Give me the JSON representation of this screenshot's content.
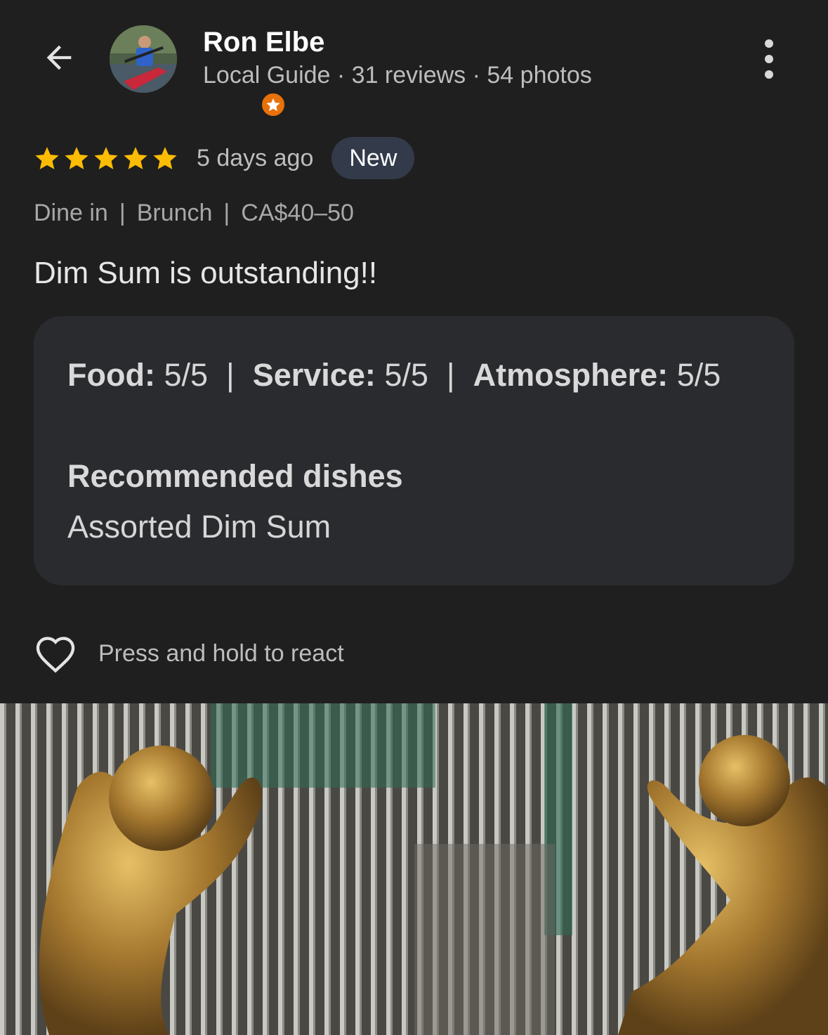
{
  "header": {
    "back_icon": "arrow-left-icon",
    "reviewer_name": "Ron Elbe",
    "reviewer_meta": "Local Guide · 31 reviews · 54 photos",
    "badge_icon": "local-guide-star-icon",
    "more_icon": "more-vert-icon"
  },
  "review": {
    "rating": 5,
    "rating_max": 5,
    "time": "5 days ago",
    "badge": "New",
    "tags": [
      "Dine in",
      "Brunch",
      "CA$40–50"
    ],
    "text": "Dim Sum is outstanding!!",
    "attributes": [
      {
        "label": "Food:",
        "value": "5/5"
      },
      {
        "label": "Service:",
        "value": "5/5"
      },
      {
        "label": "Atmosphere:",
        "value": "5/5"
      }
    ],
    "recommended_title": "Recommended dishes",
    "recommended_value": "Assorted Dim Sum"
  },
  "reaction": {
    "icon": "heart-outline-icon",
    "label": "Press and hold to react"
  },
  "colors": {
    "background": "#1f1f1f",
    "card": "#2a2b2e",
    "star": "#fbbc04",
    "badge_new_bg": "#333a4a",
    "guide_badge": "#e8710a"
  }
}
